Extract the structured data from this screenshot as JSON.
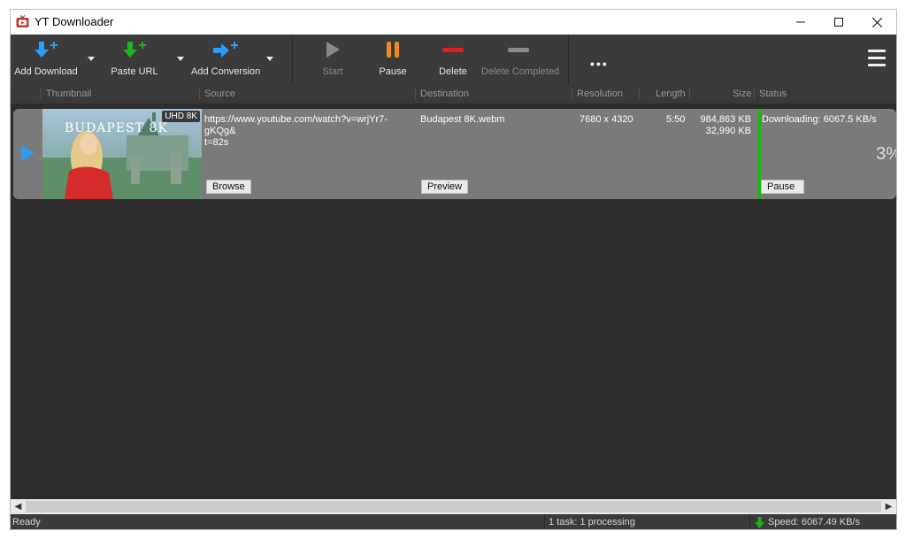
{
  "window": {
    "title": "YT Downloader"
  },
  "toolbar": {
    "add_download": "Add Download",
    "paste_url": "Paste URL",
    "add_conversion": "Add Conversion",
    "start": "Start",
    "pause": "Pause",
    "delete": "Delete",
    "delete_completed": "Delete Completed",
    "more": "•••"
  },
  "columns": {
    "thumbnail": "Thumbnail",
    "source": "Source",
    "destination": "Destination",
    "resolution": "Resolution",
    "length": "Length",
    "size": "Size",
    "status": "Status"
  },
  "task": {
    "badge": "UHD 8K",
    "thumb_title": "BUDAPEST 8K",
    "source_line1": "https://www.youtube.com/watch?v=wrjYr7-gKQg&",
    "source_line2": "t=82s",
    "destination": "Budapest 8K.webm",
    "resolution": "7680 x 4320",
    "length": "5:50",
    "size_total": "984,863 KB",
    "size_done": "32,990 KB",
    "status": "Downloading: 6067.5 KB/s",
    "progress_percent": "3%",
    "browse_label": "Browse",
    "preview_label": "Preview",
    "pause_label": "Pause"
  },
  "statusbar": {
    "state": "Ready",
    "tasks": "1 task: 1 processing",
    "speed": "Speed: 6067.49 KB/s"
  },
  "colors": {
    "accent_blue": "#2a9df4",
    "accent_green": "#1eb31e",
    "pause_orange": "#f08a1a",
    "delete_red": "#e02020"
  }
}
